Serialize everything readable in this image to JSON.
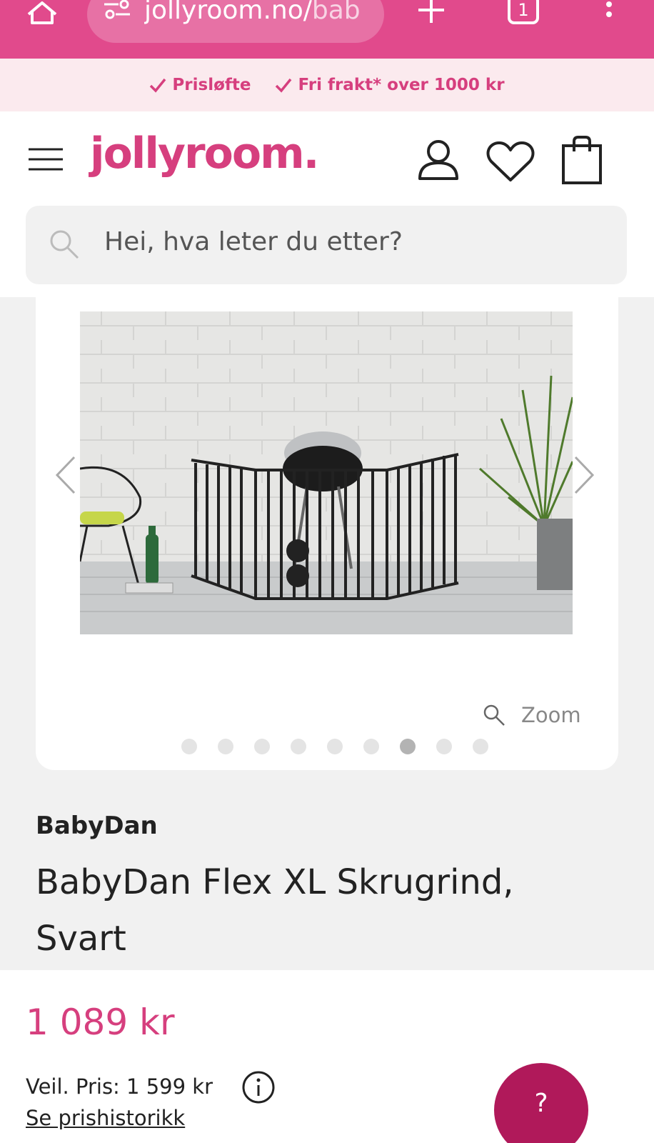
{
  "browser": {
    "url_main": "jollyroom.no/",
    "url_dim": "bab",
    "tab_count": "1"
  },
  "usp": [
    {
      "label": "Prisløfte"
    },
    {
      "label": "Fri frakt* over 1000 kr"
    }
  ],
  "header": {
    "logo": "jollyroom."
  },
  "search": {
    "placeholder": "Hei, hva leter du etter?"
  },
  "gallery": {
    "zoom_label": "Zoom",
    "dot_count": 9,
    "active_dot": 7
  },
  "product": {
    "brand": "BabyDan",
    "title": "BabyDan Flex XL Skrugrind, Svart",
    "price": "1 089 kr",
    "rrp": "Veil. Pris: 1 599 kr",
    "price_history_link": "Se prishistorikk"
  },
  "help": {
    "label": "?"
  },
  "colors": {
    "brand_pink": "#d63f7e",
    "browser_bar": "#e14a8c",
    "help_button": "#b0195a"
  }
}
